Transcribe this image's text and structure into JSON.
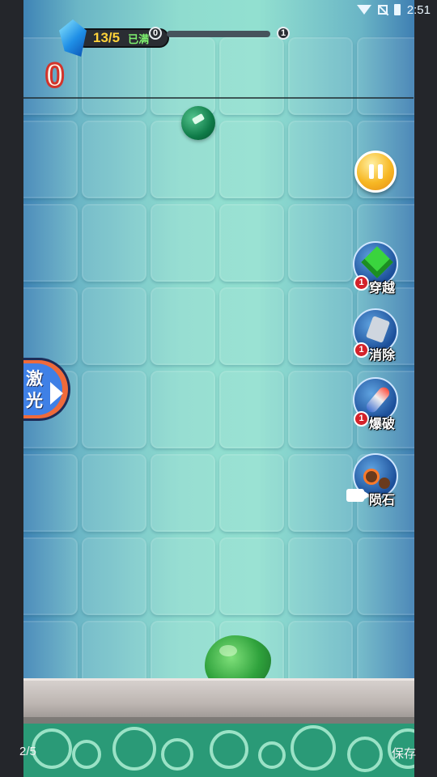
{
  "status": {
    "time": "2:51"
  },
  "hud": {
    "energy_count": "13/5",
    "energy_full": "已满",
    "level_current": "0",
    "level_next": "1",
    "level_progress": 0,
    "score": "0"
  },
  "tools": [
    {
      "id": "pass",
      "label": "穿越",
      "badge": "1",
      "icon": "green-cube-icon"
    },
    {
      "id": "clear",
      "label": "消除",
      "badge": "1",
      "icon": "cleaver-icon"
    },
    {
      "id": "blast",
      "label": "爆破",
      "badge": "1",
      "icon": "rocket-icon"
    },
    {
      "id": "meteor",
      "label": "陨石",
      "badge": "",
      "icon": "meteor-icon",
      "via": "video-ad-icon"
    }
  ],
  "laser": {
    "label": "激光"
  },
  "viewer": {
    "page": "2/5",
    "save": "保存"
  },
  "colors": {
    "accent": "#ffd23a",
    "score_stroke": "#d2342b",
    "badge": "#d3222a",
    "laser_bg": "#3f80e6"
  }
}
